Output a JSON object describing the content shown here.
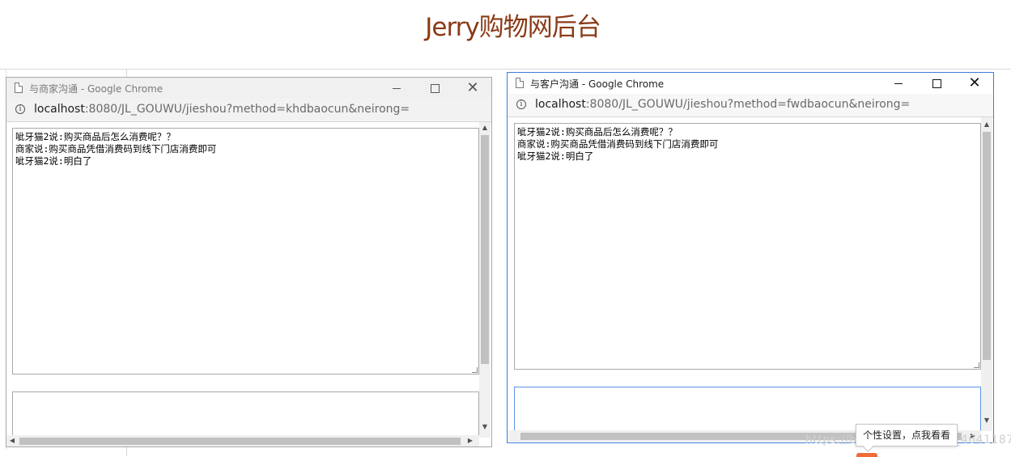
{
  "page": {
    "title": "Jerry购物网后台"
  },
  "merchant_window": {
    "title": "与商家沟通 - Google Chrome",
    "url_host": "localhost",
    "url_rest": ":8080/JL_GOUWU/jieshou?method=khdbaocun&neirong=",
    "messages": [
      "呲牙猫2说:购买商品后怎么消费呢？？",
      "商家说:购买商品凭借消费码到线下门店消费即可",
      "呲牙猫2说:明白了"
    ],
    "input_value": ""
  },
  "customer_window": {
    "title": "与客户沟通 - Google Chrome",
    "url_host": "localhost",
    "url_rest": ":8080/JL_GOUWU/jieshou?method=fwdbaocun&neirong=",
    "messages": [
      "呲牙猫2说:购买商品后怎么消费呢？？",
      "商家说:购买商品凭借消费码到线下门店消费即可",
      "呲牙猫2说:明白了"
    ],
    "input_value": ""
  },
  "window_controls": {
    "minimize": "—",
    "maximize": "☐",
    "close": "✕"
  },
  "tooltip": {
    "text": "个性设置，点我看看"
  },
  "watermark": {
    "text": "https://blog.csdn.net/m0_46411870"
  },
  "colors": {
    "title": "#8a3a16",
    "active_border": "#3b7ddb",
    "accent": "#f06a3a"
  },
  "icons": [
    "document-icon",
    "info-icon",
    "minimize-icon",
    "maximize-icon",
    "close-icon",
    "scroll-up-arrow-icon",
    "scroll-down-arrow-icon",
    "scroll-left-arrow-icon",
    "scroll-right-arrow-icon",
    "resize-grip-icon"
  ]
}
